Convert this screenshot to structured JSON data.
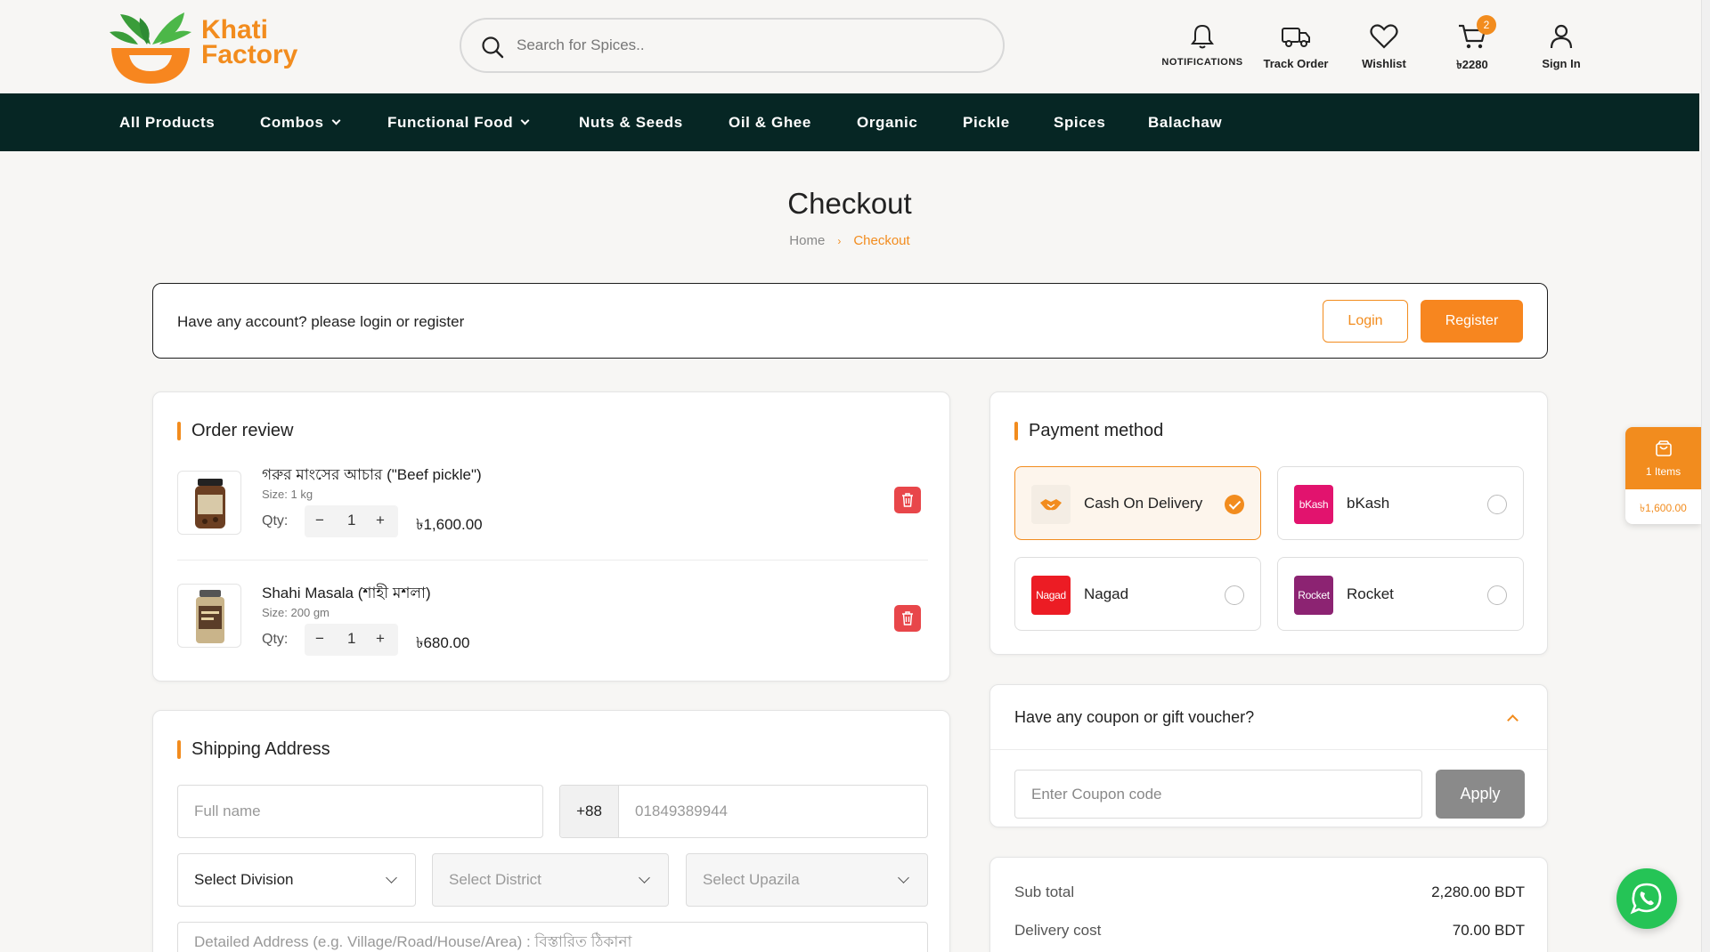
{
  "header": {
    "logo_line1": "Khati",
    "logo_line2": "Factory",
    "search_placeholder": "Search for Spices..",
    "notifications_label": "NOTIFICATIONS",
    "track_order_label": "Track Order",
    "wishlist_label": "Wishlist",
    "cart_total": "৳2280",
    "cart_count": "2",
    "sign_in_label": "Sign In"
  },
  "nav": {
    "items": [
      {
        "label": "All Products",
        "has_dropdown": false
      },
      {
        "label": "Combos",
        "has_dropdown": true
      },
      {
        "label": "Functional Food",
        "has_dropdown": true
      },
      {
        "label": "Nuts & Seeds",
        "has_dropdown": false
      },
      {
        "label": "Oil & Ghee",
        "has_dropdown": false
      },
      {
        "label": "Organic",
        "has_dropdown": false
      },
      {
        "label": "Pickle",
        "has_dropdown": false
      },
      {
        "label": "Spices",
        "has_dropdown": false
      },
      {
        "label": "Balachaw",
        "has_dropdown": false
      }
    ]
  },
  "page": {
    "title": "Checkout",
    "breadcrumb": [
      "Home",
      "Checkout"
    ]
  },
  "login_box": {
    "message": "Have any account? please login or register",
    "login_label": "Login",
    "register_label": "Register"
  },
  "order_review": {
    "title": "Order review",
    "qty_label": "Qty:",
    "items": [
      {
        "name": "গরুর মাংসের আচার (\"Beef pickle\")",
        "size": "Size: 1 kg",
        "qty": "1",
        "price": "৳1,600.00"
      },
      {
        "name": "Shahi Masala (শাহী মশলা)",
        "size": "Size: 200 gm",
        "qty": "1",
        "price": "৳680.00"
      }
    ]
  },
  "shipping": {
    "title": "Shipping Address",
    "full_name_placeholder": "Full name",
    "phone_code": "+88",
    "phone_placeholder": "01849389944",
    "division_label": "Select Division",
    "district_label": "Select District",
    "upazila_label": "Select Upazila",
    "address_placeholder": "Detailed Address (e.g. Village/Road/House/Area) : বিস্তারিত ঠিকানা"
  },
  "payment": {
    "title": "Payment method",
    "options": [
      {
        "name": "Cash On Delivery",
        "logo_text": "",
        "color": "#f28c1e",
        "selected": true
      },
      {
        "name": "bKash",
        "logo_text": "bKash",
        "color": "#e2136e",
        "selected": false
      },
      {
        "name": "Nagad",
        "logo_text": "Nagad",
        "color": "#ec1c24",
        "selected": false
      },
      {
        "name": "Rocket",
        "logo_text": "Rocket",
        "color": "#8c2372",
        "selected": false
      }
    ]
  },
  "coupon": {
    "title": "Have any coupon or gift voucher?",
    "placeholder": "Enter Coupon code",
    "apply_label": "Apply"
  },
  "summary": {
    "subtotal_label": "Sub total",
    "subtotal_value": "2,280.00 BDT",
    "delivery_label": "Delivery cost",
    "delivery_value": "70.00 BDT"
  },
  "floating_cart": {
    "items_label": "1 Items",
    "amount": "৳1,600.00"
  },
  "colors": {
    "accent": "#f28c1e",
    "nav_bg": "#062624",
    "whatsapp": "#25c456",
    "delete": "#e8464a"
  }
}
